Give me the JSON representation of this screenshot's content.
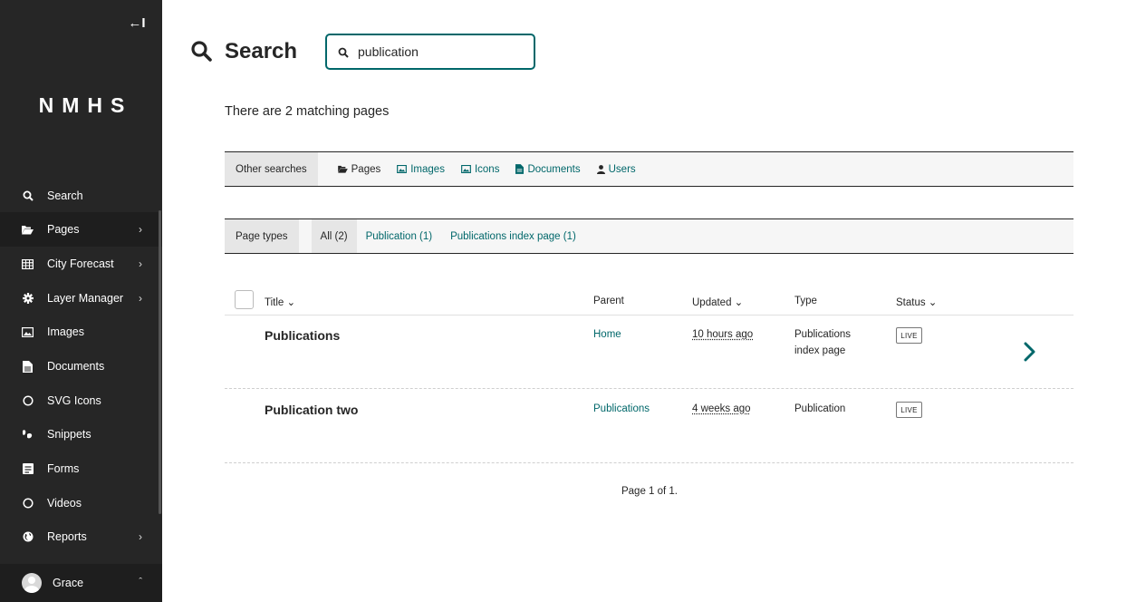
{
  "sidebar": {
    "collapse_label": "←I",
    "logo": "NMHS",
    "items": [
      {
        "label": "Search",
        "icon": "search-icon"
      },
      {
        "label": "Pages",
        "icon": "folder-open-icon",
        "arrow": "›"
      },
      {
        "label": "City Forecast",
        "icon": "table-icon",
        "arrow": "›"
      },
      {
        "label": "Layer Manager",
        "icon": "cog-icon",
        "arrow": "›"
      },
      {
        "label": "Images",
        "icon": "image-icon"
      },
      {
        "label": "Documents",
        "icon": "document-icon"
      },
      {
        "label": "SVG Icons",
        "icon": "circle-icon"
      },
      {
        "label": "Snippets",
        "icon": "snippet-icon"
      },
      {
        "label": "Forms",
        "icon": "form-icon"
      },
      {
        "label": "Videos",
        "icon": "circle-icon"
      },
      {
        "label": "Reports",
        "icon": "globe-icon",
        "arrow": "›"
      }
    ],
    "account": {
      "name": "Grace",
      "arrow": "ˆ"
    }
  },
  "header": {
    "title": "Search",
    "search_value": "publication"
  },
  "results": {
    "summary": "There are 2 matching pages"
  },
  "other_searches": {
    "label": "Other searches",
    "links": [
      {
        "label": "Pages",
        "icon": "folder-open-icon"
      },
      {
        "label": "Images",
        "icon": "image-icon"
      },
      {
        "label": "Icons",
        "icon": "image-icon"
      },
      {
        "label": "Documents",
        "icon": "document-icon"
      },
      {
        "label": "Users",
        "icon": "user-icon"
      }
    ]
  },
  "page_types": {
    "label": "Page types",
    "all": "All (2)",
    "links": [
      "Publication (1)",
      "Publications index page (1)"
    ]
  },
  "table": {
    "columns": {
      "title": "Title ⌄",
      "parent": "Parent",
      "updated": "Updated ⌄",
      "type": "Type",
      "status": "Status ⌄"
    },
    "rows": [
      {
        "title": "Publications",
        "parent": "Home",
        "updated": "10 hours ago",
        "type_line1": "Publications",
        "type_line2": "index page",
        "status": "LIVE"
      },
      {
        "title": "Publication two",
        "parent": "Publications",
        "updated": "4 weeks ago",
        "type_line1": "Publication",
        "type_line2": "",
        "status": "LIVE"
      }
    ]
  },
  "pagination": {
    "text": "Page 1 of 1."
  },
  "colors": {
    "accent": "#00676a",
    "sidebar_bg": "#262626"
  }
}
